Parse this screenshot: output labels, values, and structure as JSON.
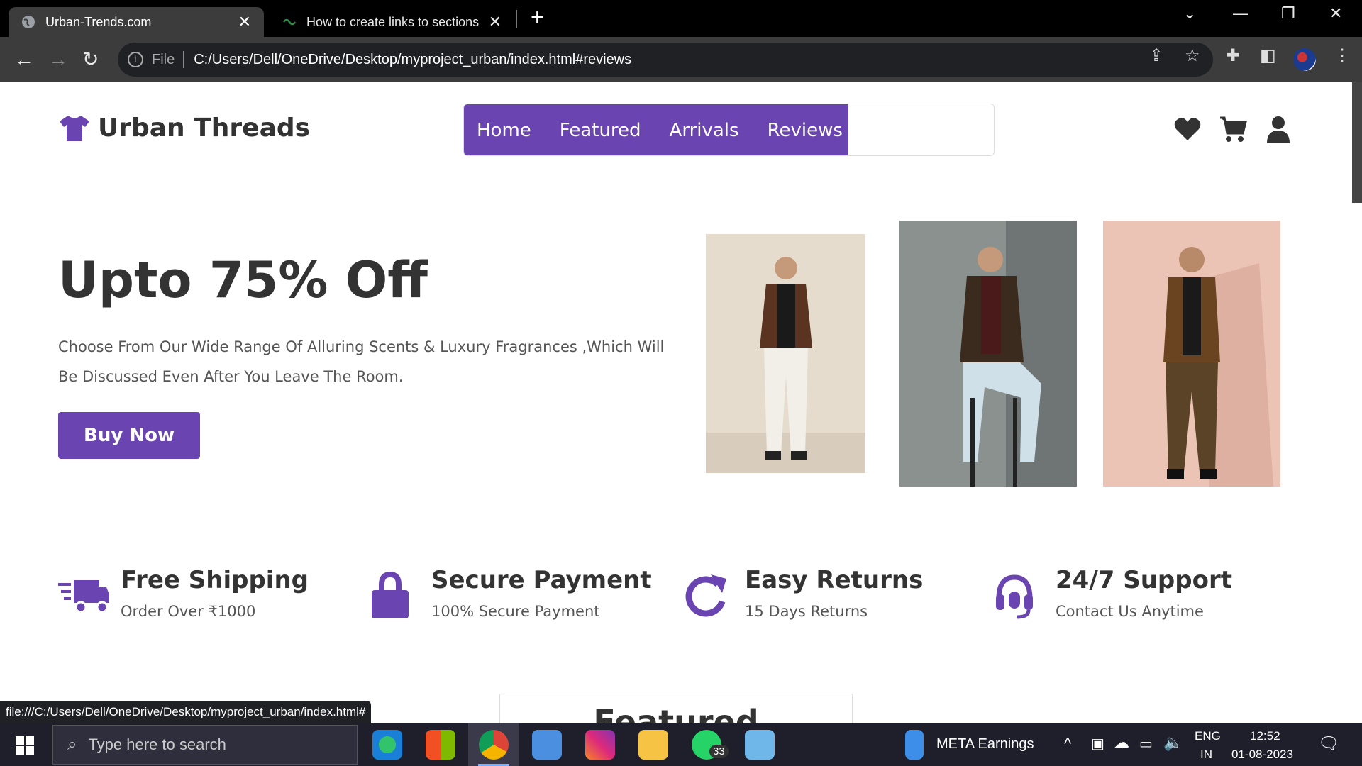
{
  "browser": {
    "tabs": [
      {
        "title": "Urban-Trends.com",
        "active": true
      },
      {
        "title": "How to create links to sections w",
        "active": false
      }
    ],
    "address": {
      "scheme_label": "File",
      "url": "C:/Users/Dell/OneDrive/Desktop/myproject_urban/index.html#reviews"
    },
    "status_url": "file:///C:/Users/Dell/OneDrive/Desktop/myproject_urban/index.html#"
  },
  "site": {
    "brand": "Urban Threads",
    "nav": [
      "Home",
      "Featured",
      "Arrivals",
      "Reviews"
    ],
    "hero": {
      "heading": "Upto 75% Off",
      "text": "Choose From Our Wide Range Of Alluring Scents & Luxury Fragrances ,Which Will Be Discussed Even After You Leave The Room.",
      "button": "Buy Now"
    },
    "features": [
      {
        "title": "Free Shipping",
        "subtitle": "Order Over ₹1000",
        "icon": "truck-icon"
      },
      {
        "title": "Secure Payment",
        "subtitle": "100% Secure Payment",
        "icon": "lock-icon"
      },
      {
        "title": "Easy Returns",
        "subtitle": "15 Days Returns",
        "icon": "redo-icon"
      },
      {
        "title": "24/7 Support",
        "subtitle": "Contact Us Anytime",
        "icon": "headset-icon"
      }
    ],
    "section_title": "Featured Perfumes",
    "accent": "#6a45b1"
  },
  "taskbar": {
    "search_placeholder": "Type here to search",
    "whatsapp_badge": "33",
    "widget": "META  Earnings",
    "lang_top": "ENG",
    "lang_bottom": "IN",
    "time": "12:52",
    "date": "01-08-2023"
  }
}
